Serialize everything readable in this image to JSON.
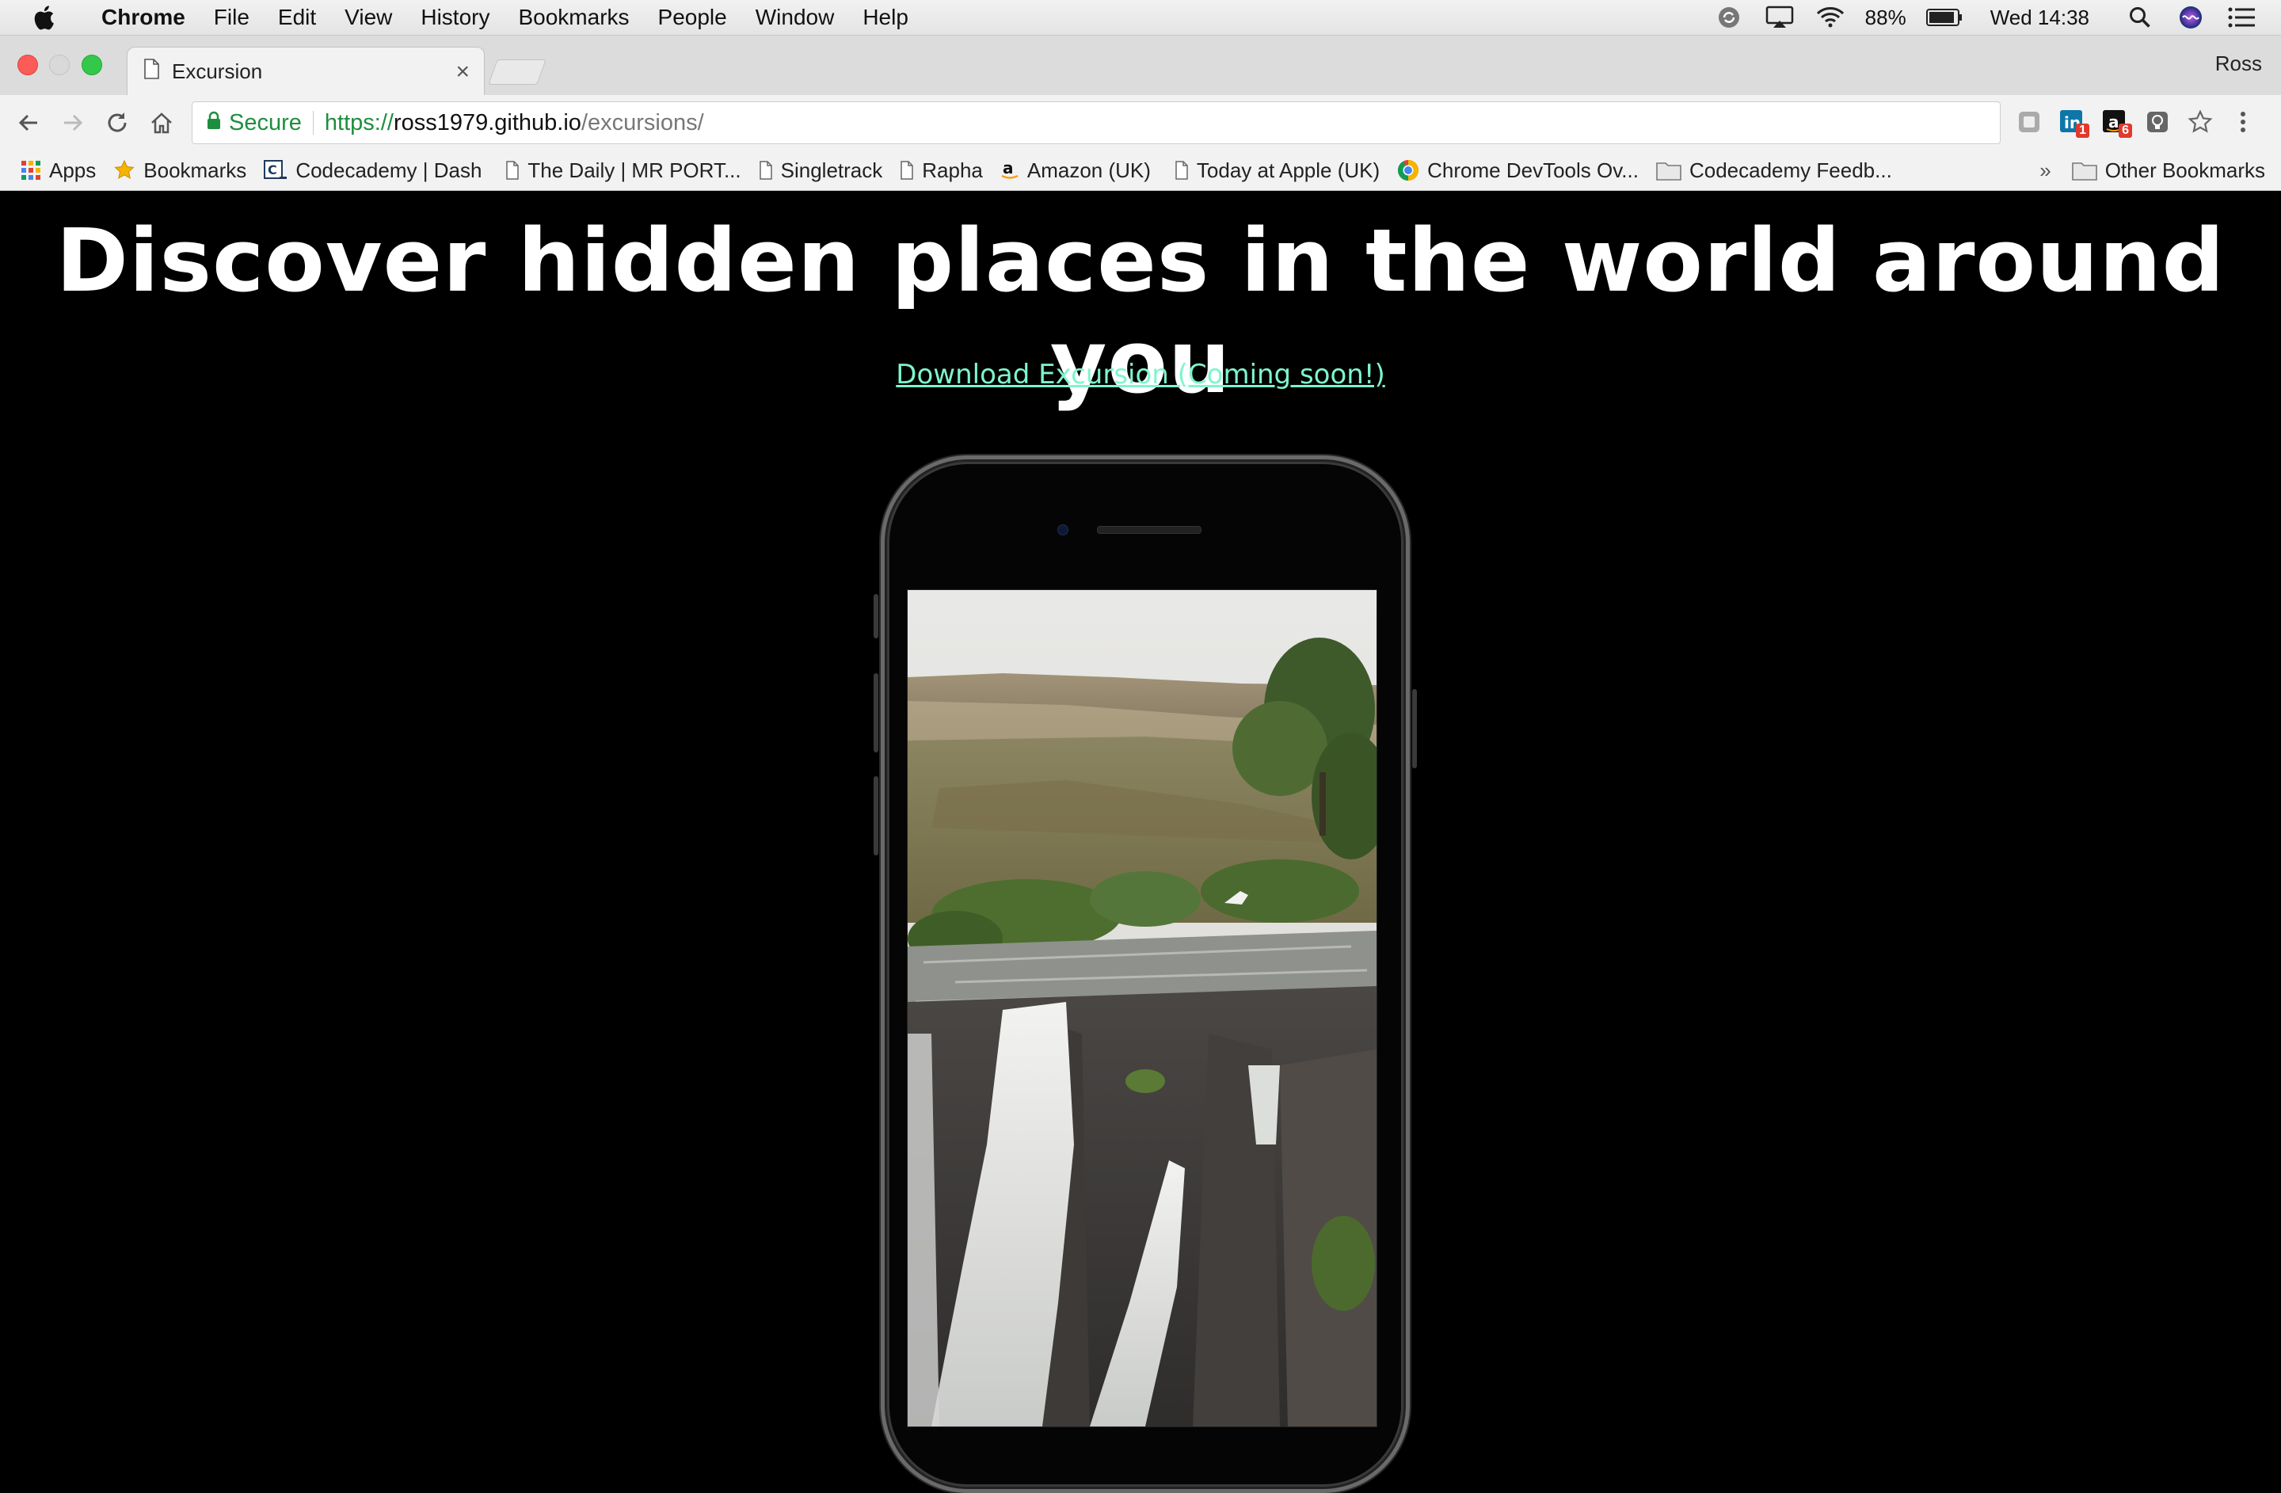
{
  "menubar": {
    "app": "Chrome",
    "menus": [
      "File",
      "Edit",
      "View",
      "History",
      "Bookmarks",
      "People",
      "Window",
      "Help"
    ],
    "battery": "88%",
    "clock": "Wed 14:38"
  },
  "window": {
    "tab_title": "Excursion",
    "profile": "Ross"
  },
  "toolbar": {
    "secure_label": "Secure",
    "url_scheme": "https://",
    "url_host": "ross1979.github.io",
    "url_path": "/excursions/",
    "extension_badges": [
      "1",
      "6"
    ]
  },
  "bookmarks": {
    "items": [
      {
        "label": "Apps",
        "icon": "apps-grid-icon"
      },
      {
        "label": "Bookmarks",
        "icon": "star-icon"
      },
      {
        "label": "Codecademy | Dash",
        "icon": "codecademy-icon"
      },
      {
        "label": "The Daily | MR PORT...",
        "icon": "page-icon"
      },
      {
        "label": "Singletrack",
        "icon": "page-icon"
      },
      {
        "label": "Rapha",
        "icon": "page-icon"
      },
      {
        "label": "Amazon (UK)",
        "icon": "amazon-icon"
      },
      {
        "label": "Today at Apple (UK)",
        "icon": "page-icon"
      },
      {
        "label": "Chrome DevTools Ov...",
        "icon": "chrome-icon"
      },
      {
        "label": "Codecademy Feedb...",
        "icon": "folder-icon"
      }
    ],
    "other": "Other Bookmarks"
  },
  "page": {
    "headline": "Discover hidden places in the world around you",
    "download_link": "Download Excursion (Coming soon!)"
  },
  "colors": {
    "link": "#7ff5cc",
    "secure_green": "#1e8e3e",
    "background": "#000000"
  }
}
